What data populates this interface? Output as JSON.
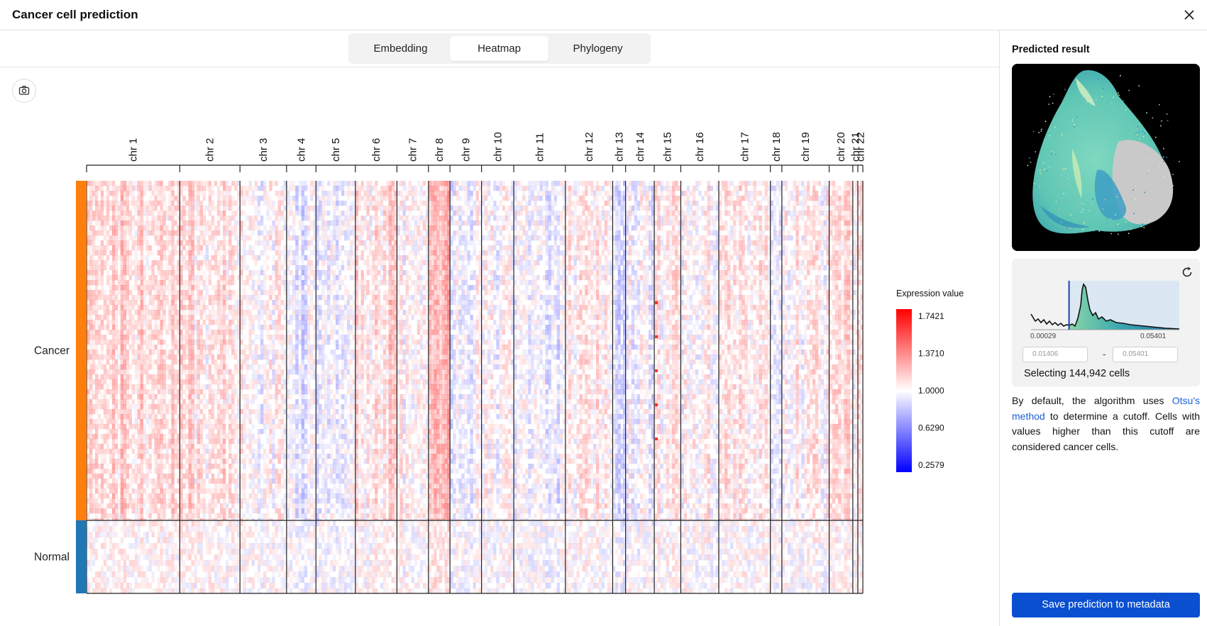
{
  "window": {
    "title": "Cancer cell prediction",
    "close_icon": "close-icon"
  },
  "tabs": [
    {
      "label": "Embedding",
      "active": false
    },
    {
      "label": "Heatmap",
      "active": true
    },
    {
      "label": "Phylogeny",
      "active": false
    }
  ],
  "toolbar": {
    "camera_icon": "camera-icon"
  },
  "heatmap": {
    "chromosomes": [
      "chr 1",
      "chr 2",
      "chr 3",
      "chr 4",
      "chr 5",
      "chr 6",
      "chr 7",
      "chr 8",
      "chr 9",
      "chr 10",
      "chr 11",
      "chr 12",
      "chr 13",
      "chr 14",
      "chr 15",
      "chr 16",
      "chr 17",
      "chr 18",
      "chr 19",
      "chr 20",
      "chr 21",
      "chr 22"
    ],
    "chromosome_relative_widths": [
      130,
      84,
      65,
      41,
      55,
      58,
      44,
      30,
      44,
      45,
      72,
      66,
      18,
      40,
      37,
      53,
      72,
      16,
      66,
      33,
      7,
      7
    ],
    "groups": [
      {
        "label": "Cancer",
        "color": "#ff7f0e",
        "relative_size": 4.65
      },
      {
        "label": "Normal",
        "color": "#1f77b4",
        "relative_size": 1.0
      }
    ],
    "legend": {
      "title": "Expression value",
      "ticks": [
        "1.7421",
        "1.3710",
        "1.0000",
        "0.6290",
        "0.2579"
      ],
      "min": 0.2579,
      "max": 1.7421,
      "color_high": "#ff0000",
      "color_mid": "#ffffff",
      "color_low": "#0000ff"
    }
  },
  "side": {
    "title": "Predicted result",
    "histogram": {
      "min_label": "0.00029",
      "max_label": "0.05401",
      "min_value": 0.00029,
      "max_value": 0.05401,
      "cutoff": 0.01406,
      "input_low": "0.01406",
      "input_high": "0.05401",
      "reset_icon": "refresh-icon"
    },
    "range_dash": "-",
    "selecting_text": "Selecting 144,942 cells",
    "description_prefix": "By default, the algorithm uses ",
    "description_link": "Otsu's method",
    "description_suffix": " to determine a cutoff. Cells with values higher than this cutoff are considered cancer cells.",
    "save_label": "Save prediction to metadata"
  },
  "colors": {
    "accent": "#0a4fd0",
    "link": "#1a5fd6",
    "cancer": "#ff7f0e",
    "normal": "#1f77b4"
  }
}
